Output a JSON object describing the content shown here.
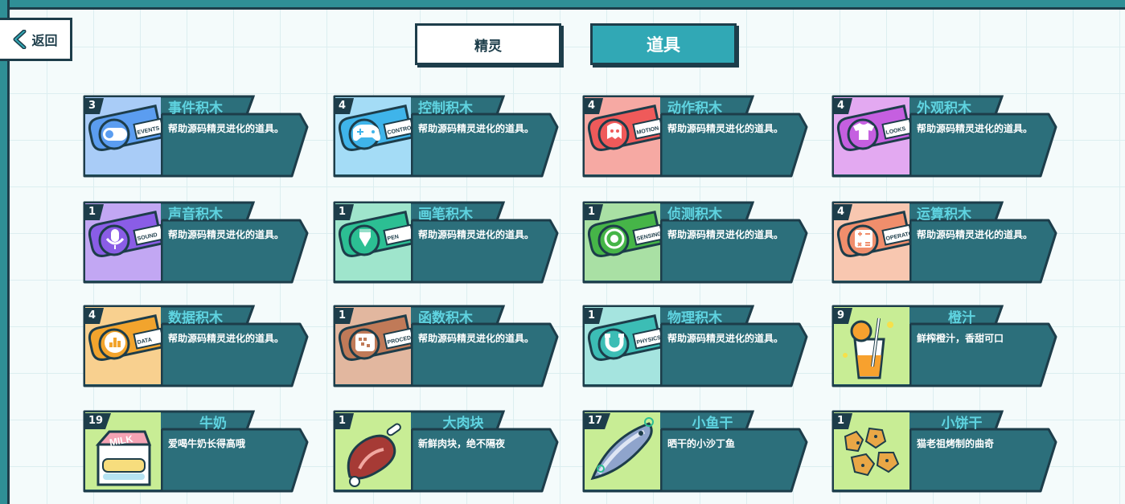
{
  "back_button": {
    "label": "返回"
  },
  "tabs": [
    {
      "label": "精灵",
      "active": false
    },
    {
      "label": "道具",
      "active": true
    }
  ],
  "colors": {
    "frame": "#2f8f96",
    "outline": "#1d3d4a",
    "card_panel": "#2c6f7b",
    "title_text": "#5fd3e0",
    "active_tab": "#31a8b5"
  },
  "items": [
    {
      "count": "3",
      "title": "事件积木",
      "desc": "帮助源码精灵进化的道具。",
      "icon": "events-block-icon",
      "tag": "EVENTS",
      "color": "#5b9df0",
      "bg": "#a9ccf7"
    },
    {
      "count": "4",
      "title": "控制积木",
      "desc": "帮助源码精灵进化的道具。",
      "icon": "control-block-icon",
      "tag": "CONTROL",
      "color": "#3fb4ea",
      "bg": "#a4dcf6"
    },
    {
      "count": "4",
      "title": "动作积木",
      "desc": "帮助源码精灵进化的道具。",
      "icon": "motion-block-icon",
      "tag": "MOTION",
      "color": "#ef5a5a",
      "bg": "#f6a9a3"
    },
    {
      "count": "4",
      "title": "外观积木",
      "desc": "帮助源码精灵进化的道具。",
      "icon": "looks-block-icon",
      "tag": "LOOKS",
      "color": "#c55fe0",
      "bg": "#e3a9f1"
    },
    {
      "count": "1",
      "title": "声音积木",
      "desc": "帮助源码精灵进化的道具。",
      "icon": "sound-block-icon",
      "tag": "SOUND",
      "color": "#8a5de6",
      "bg": "#c2a7f3"
    },
    {
      "count": "1",
      "title": "画笔积木",
      "desc": "帮助源码精灵进化的道具。",
      "icon": "pen-block-icon",
      "tag": "PEN",
      "color": "#2cbf93",
      "bg": "#9fe5cc"
    },
    {
      "count": "1",
      "title": "侦测积木",
      "desc": "帮助源码精灵进化的道具。",
      "icon": "sensing-block-icon",
      "tag": "SENSING",
      "color": "#46b548",
      "bg": "#a9e0a4"
    },
    {
      "count": "4",
      "title": "运算积木",
      "desc": "帮助源码精灵进化的道具。",
      "icon": "operators-block-icon",
      "tag": "OPERATORS",
      "color": "#f08e6c",
      "bg": "#f8c7b0"
    },
    {
      "count": "4",
      "title": "数据积木",
      "desc": "帮助源码精灵进化的道具。",
      "icon": "data-block-icon",
      "tag": "DATA",
      "color": "#f2a42d",
      "bg": "#f8d08f"
    },
    {
      "count": "1",
      "title": "函数积木",
      "desc": "帮助源码精灵进化的道具。",
      "icon": "procedures-block-icon",
      "tag": "PROCEDURES",
      "color": "#c07a58",
      "bg": "#e2b79f"
    },
    {
      "count": "1",
      "title": "物理积木",
      "desc": "帮助源码精灵进化的道具。",
      "icon": "physics-block-icon",
      "tag": "PHYSICS",
      "color": "#3cbdb5",
      "bg": "#a5e4df"
    },
    {
      "count": "9",
      "title": "橙汁",
      "desc": "鲜榨橙汁，香甜可口",
      "icon": "orange-juice-icon",
      "tag": "",
      "color": "#f7a12e",
      "bg": "#c8ed95"
    },
    {
      "count": "19",
      "title": "牛奶",
      "desc": "爱喝牛奶长得高哦",
      "icon": "milk-carton-icon",
      "tag": "",
      "color": "#f5a3b4",
      "bg": "#c8ed95"
    },
    {
      "count": "1",
      "title": "大肉块",
      "desc": "新鲜肉块，绝不隔夜",
      "icon": "meat-chunk-icon",
      "tag": "",
      "color": "#a63a35",
      "bg": "#c8ed95"
    },
    {
      "count": "17",
      "title": "小鱼干",
      "desc": "晒干的小沙丁鱼",
      "icon": "dried-fish-icon",
      "tag": "",
      "color": "#7b8fb8",
      "bg": "#c8ed95"
    },
    {
      "count": "1",
      "title": "小饼干",
      "desc": "猫老祖烤制的曲奇",
      "icon": "cookies-icon",
      "tag": "",
      "color": "#e9a746",
      "bg": "#c8ed95"
    }
  ]
}
